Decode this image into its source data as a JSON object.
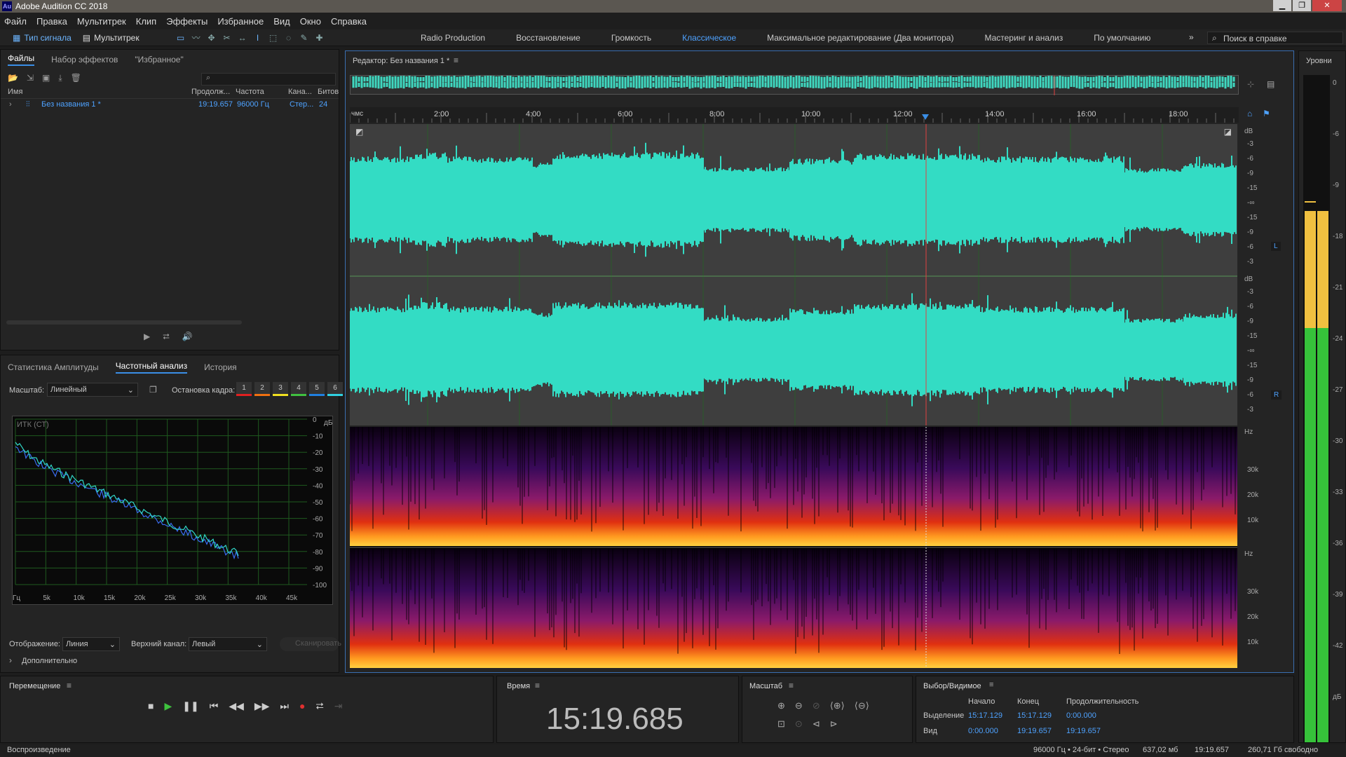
{
  "app": {
    "title": "Adobe Audition CC 2018",
    "logo": "Au"
  },
  "menu": [
    "Файл",
    "Правка",
    "Мультитрек",
    "Клип",
    "Эффекты",
    "Избранное",
    "Вид",
    "Окно",
    "Справка"
  ],
  "toolbar": {
    "mode_waveform": "Тип сигнала",
    "mode_multitrack": "Мультитрек",
    "workspaces": [
      "Radio Production",
      "Восстановление",
      "Громкость",
      "Классическое",
      "Максимальное редактирование (Два монитора)",
      "Мастеринг и анализ",
      "По умолчанию"
    ],
    "active_workspace": "Классическое",
    "search_placeholder": "Поиск в справке"
  },
  "files": {
    "tabs": [
      "Файлы",
      "Набор эффектов",
      "\"Избранное\""
    ],
    "columns": [
      "Имя",
      "Продолж...",
      "Частота",
      "Кана...",
      "Битов"
    ],
    "rows": [
      {
        "name": "Без названия 1 *",
        "duration": "19:19.657",
        "rate": "96000 Гц",
        "channels": "Стер...",
        "bits": "24"
      }
    ]
  },
  "analysis": {
    "tabs": [
      "Статистика Амплитуды",
      "Частотный анализ",
      "История"
    ],
    "scale_label": "Масштаб:",
    "scale_value": "Линейный",
    "freeze_label": "Остановка кадра:",
    "freeze_slots": [
      "1",
      "2",
      "3",
      "4",
      "5",
      "6"
    ],
    "freeze_colors": [
      "#e02020",
      "#f07010",
      "#f0e020",
      "#40c040",
      "#2080e0",
      "#30d0e0"
    ],
    "graph_title": "ИТК (СТ)",
    "y_unit": "дБ",
    "y_ticks": [
      "0",
      "-10",
      "-20",
      "-30",
      "-40",
      "-50",
      "-60",
      "-70",
      "-80",
      "-90",
      "-100"
    ],
    "x_ticks": [
      "Гц",
      "5k",
      "10k",
      "15k",
      "20k",
      "25k",
      "30k",
      "35k",
      "40k",
      "45k"
    ],
    "display_label": "Отображение:",
    "display_value": "Линия",
    "channel_label": "Верхний канал:",
    "channel_value": "Левый",
    "scan_button": "Сканировать",
    "advanced": "Дополнительно"
  },
  "editor": {
    "title": "Редактор: Без названия 1 *",
    "ruler_unit": "чмс",
    "ruler_ticks": [
      "2:00",
      "4:00",
      "6:00",
      "8:00",
      "10:00",
      "12:00",
      "14:00",
      "16:00",
      "18:00"
    ],
    "db_unit": "dB",
    "db_ticks": [
      "-3",
      "-6",
      "-9",
      "-15",
      "-∞",
      "-15",
      "-9",
      "-6",
      "-3"
    ],
    "channel_left": "L",
    "channel_right": "R",
    "hz_unit": "Hz",
    "hz_ticks": [
      "30k",
      "20k",
      "10k"
    ]
  },
  "levels": {
    "title": "Уровни",
    "scale": [
      "0",
      "-6",
      "-9",
      "-18",
      "-21",
      "-24",
      "-27",
      "-30",
      "-33",
      "-36",
      "-39",
      "-42",
      "дБ"
    ]
  },
  "transport": {
    "title": "Перемещение"
  },
  "time": {
    "title": "Время",
    "value": "15:19.685"
  },
  "zoom": {
    "title": "Масштаб"
  },
  "selection": {
    "title": "Выбор/Видимое",
    "col_start": "Начало",
    "col_end": "Конец",
    "col_duration": "Продолжительность",
    "rows": [
      {
        "label": "Выделение",
        "start": "15:17.129",
        "end": "15:17.129",
        "duration": "0:00.000"
      },
      {
        "label": "Вид",
        "start": "0:00.000",
        "end": "19:19.657",
        "duration": "19:19.657"
      }
    ]
  },
  "status": {
    "left": "Воспроизведение",
    "format": "96000 Гц • 24-бит • Стерео",
    "size": "637,02 мб",
    "duration": "19:19.657",
    "free": "260,71 Гб свободно"
  }
}
